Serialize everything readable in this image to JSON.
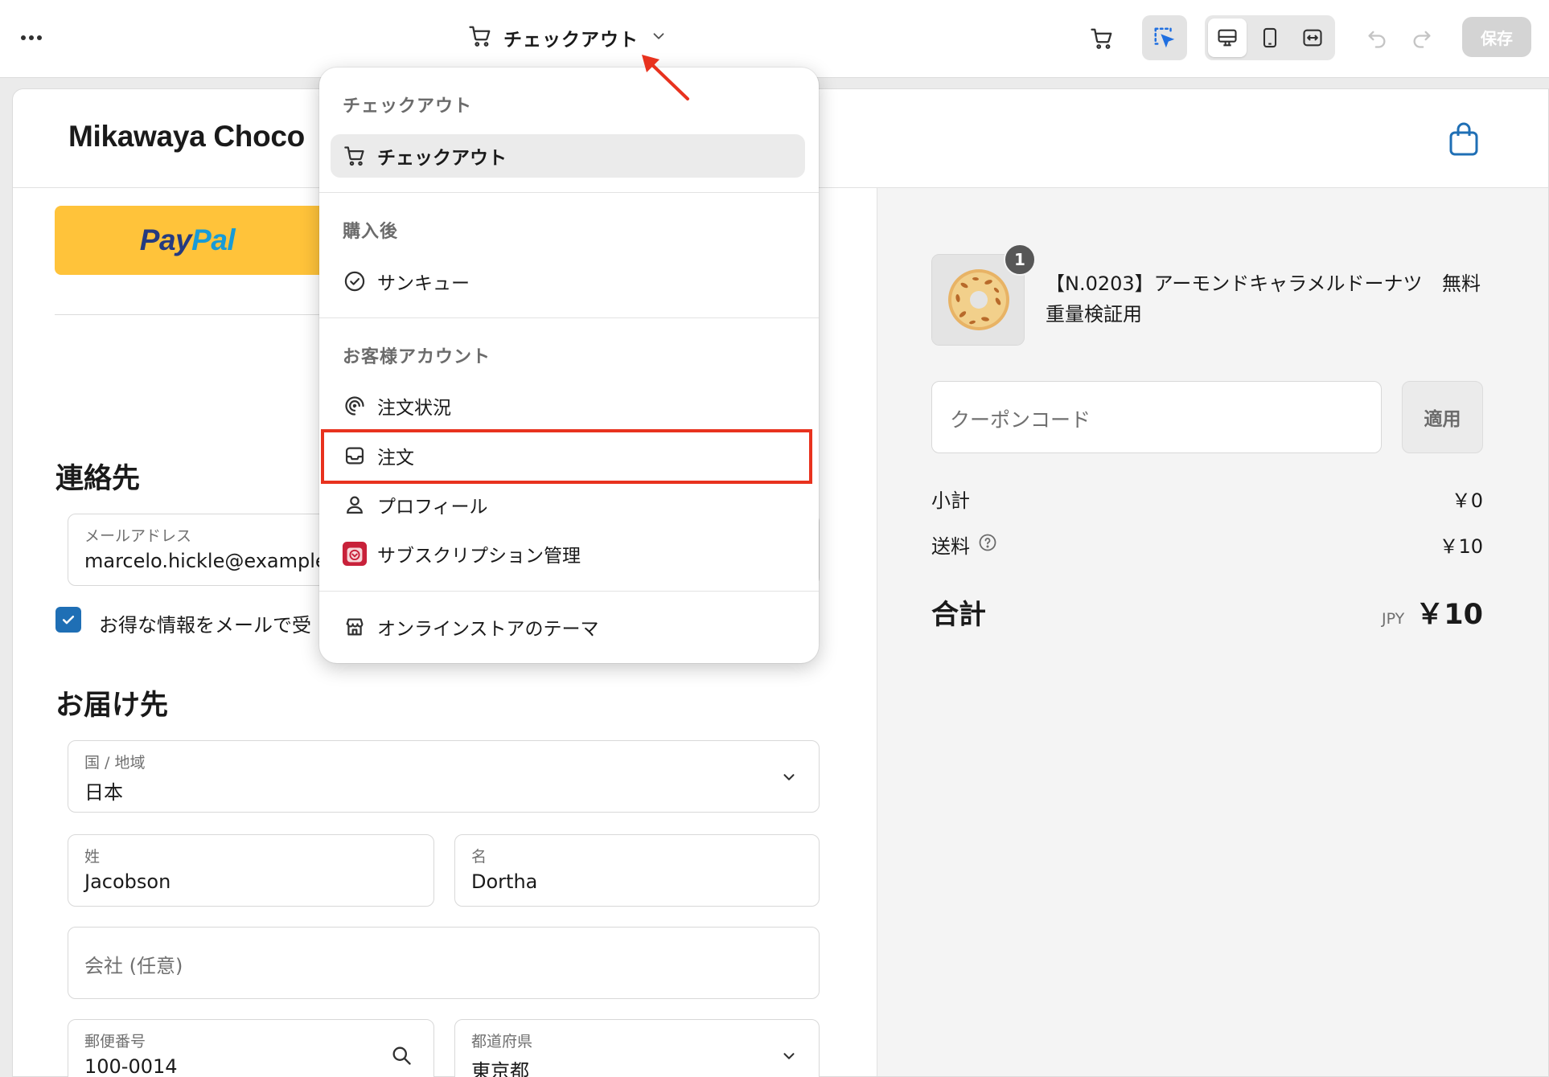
{
  "toolbar": {
    "page_title": "チェックアウト",
    "save_label": "保存",
    "icons": [
      "more-icon",
      "cart-icon",
      "chevron-down-icon",
      "inspector-select-icon",
      "desktop-view-icon",
      "mobile-view-icon",
      "fullwidth-view-icon",
      "undo-icon",
      "redo-icon"
    ]
  },
  "store": {
    "name": "Mikawaya Choco"
  },
  "express": {
    "paypal_part1": "Pay",
    "paypal_part2": "Pal"
  },
  "contact": {
    "heading": "連絡先",
    "email_label": "メールアドレス",
    "email_value": "marcelo.hickle@example.",
    "newsletter_label": "お得な情報をメールで受"
  },
  "shipping": {
    "heading": "お届け先",
    "country_label": "国 / 地域",
    "country_value": "日本",
    "last_name_label": "姓",
    "last_name_value": "Jacobson",
    "first_name_label": "名",
    "first_name_value": "Dortha",
    "company_placeholder": "会社 (任意)",
    "postal_label": "郵便番号",
    "postal_value": "100-0014",
    "prefecture_label": "都道府県",
    "prefecture_value": "東京都"
  },
  "summary": {
    "product_name": "【N.0203】アーモンドキャラメルドーナツ 重量検証用",
    "product_price": "無料",
    "quantity": "1",
    "coupon_placeholder": "クーポンコード",
    "apply_label": "適用",
    "subtotal_label": "小計",
    "subtotal_value": "￥0",
    "shipping_label": "送料",
    "shipping_value": "￥10",
    "total_label": "合計",
    "total_currency": "JPY",
    "total_value": "￥10"
  },
  "dropdown": {
    "groups": [
      {
        "title": "チェックアウト",
        "items": [
          {
            "label": "チェックアウト",
            "icon": "cart-icon",
            "selected": true
          }
        ]
      },
      {
        "title": "購入後",
        "items": [
          {
            "label": "サンキュー",
            "icon": "check-circle-icon"
          }
        ]
      },
      {
        "title": "お客様アカウント",
        "items": [
          {
            "label": "注文状況",
            "icon": "order-status-icon"
          },
          {
            "label": "注文",
            "icon": "inbox-icon",
            "highlighted": true
          },
          {
            "label": "プロフィール",
            "icon": "person-icon"
          },
          {
            "label": "サブスクリプション管理",
            "icon": "subscription-app-icon"
          }
        ]
      },
      {
        "title": "",
        "items": [
          {
            "label": "オンラインストアのテーマ",
            "icon": "store-icon"
          }
        ]
      }
    ]
  },
  "colors": {
    "annotation_red": "#e8321e",
    "paypal_yellow": "#ffc33a",
    "checkbox_blue": "#1f6fb5",
    "select_icon_blue": "#1f6fe0"
  }
}
